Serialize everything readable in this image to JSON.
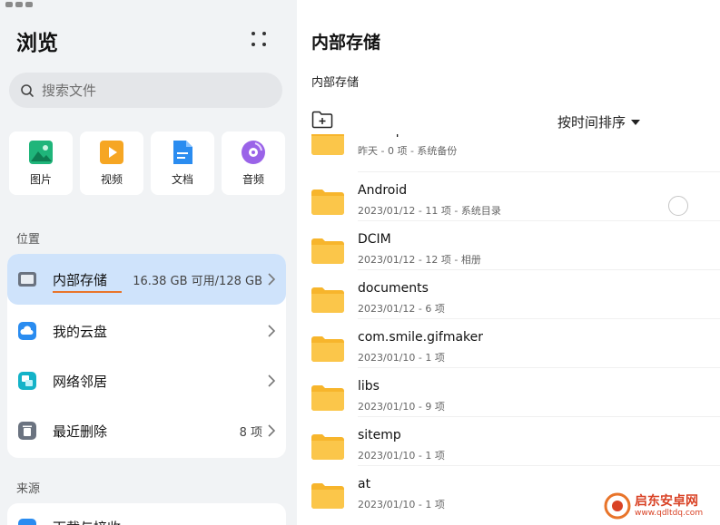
{
  "sidebar": {
    "title": "浏览",
    "search": {
      "placeholder": "搜索文件"
    },
    "categories": [
      {
        "label": "图片",
        "icon": "image-icon",
        "color": "#1fb57a"
      },
      {
        "label": "视频",
        "icon": "video-icon",
        "color": "#f6a623"
      },
      {
        "label": "文档",
        "icon": "document-icon",
        "color": "#2a8cf0"
      },
      {
        "label": "音频",
        "icon": "audio-icon",
        "color": "#9a63e8"
      }
    ],
    "locations_header": "位置",
    "locations": [
      {
        "name": "内部存储",
        "meta": "16.38 GB 可用/128 GB",
        "icon": "internal-storage-icon",
        "selected": true
      },
      {
        "name": "我的云盘",
        "meta": "",
        "icon": "cloud-drive-icon",
        "selected": false
      },
      {
        "name": "网络邻居",
        "meta": "",
        "icon": "network-neighbor-icon",
        "selected": false
      },
      {
        "name": "最近删除",
        "meta": "8 项",
        "icon": "trash-icon",
        "selected": false
      }
    ],
    "sources_header": "来源",
    "sources": [
      {
        "name": "下载与接收",
        "icon": "download-icon"
      }
    ]
  },
  "main": {
    "title": "内部存储",
    "breadcrumb": "内部存储",
    "sort_label": "按时间排序",
    "files": [
      {
        "name": "backup",
        "meta": "昨天 - 0 项 - 系统备份"
      },
      {
        "name": "Android",
        "meta": "2023/01/12 - 11 项 - 系统目录"
      },
      {
        "name": "DCIM",
        "meta": "2023/01/12 - 12 项 - 相册"
      },
      {
        "name": "documents",
        "meta": "2023/01/12 - 6 项"
      },
      {
        "name": "com.smile.gifmaker",
        "meta": "2023/01/10 - 1 项"
      },
      {
        "name": "libs",
        "meta": "2023/01/10 - 9 项"
      },
      {
        "name": "sitemp",
        "meta": "2023/01/10 - 1 项"
      },
      {
        "name": "at",
        "meta": "2023/01/10 - 1 项"
      }
    ]
  },
  "watermark": {
    "text": "启东安卓网",
    "url": "www.qdltdq.com"
  },
  "colors": {
    "accent": "#e8742a",
    "selected_bg": "#cfe3fb",
    "folder": "#f7b52c"
  }
}
